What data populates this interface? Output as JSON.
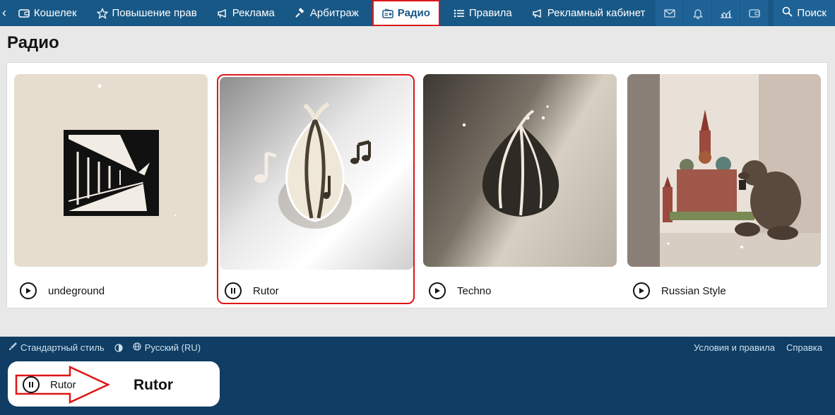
{
  "nav": {
    "items": [
      {
        "label": "Кошелек",
        "icon": "wallet-icon"
      },
      {
        "label": "Повышение прав",
        "icon": "star-icon"
      },
      {
        "label": "Реклама",
        "icon": "megaphone-icon"
      },
      {
        "label": "Арбитраж",
        "icon": "gavel-icon"
      },
      {
        "label": "Радио",
        "icon": "radio-icon",
        "active": true
      },
      {
        "label": "Правила",
        "icon": "list-icon"
      },
      {
        "label": "Рекламный кабинет",
        "icon": "megaphone-icon"
      }
    ],
    "search_label": "Поиск"
  },
  "page": {
    "title": "Радио"
  },
  "stations": [
    {
      "name": "undeground",
      "state": "play"
    },
    {
      "name": "Rutor",
      "state": "pause",
      "selected": true
    },
    {
      "name": "Techno",
      "state": "play"
    },
    {
      "name": "Russian Style",
      "state": "play"
    }
  ],
  "footer": {
    "style_label": "Стандартный стиль",
    "language_label": "Русский (RU)",
    "terms_label": "Условия и правила",
    "help_label": "Справка"
  },
  "player": {
    "station_label": "Rutor",
    "highlight_label": "Rutor"
  },
  "colors": {
    "nav_bg": "#185886",
    "footer_bg": "#0f3d63",
    "highlight": "#e01515"
  }
}
